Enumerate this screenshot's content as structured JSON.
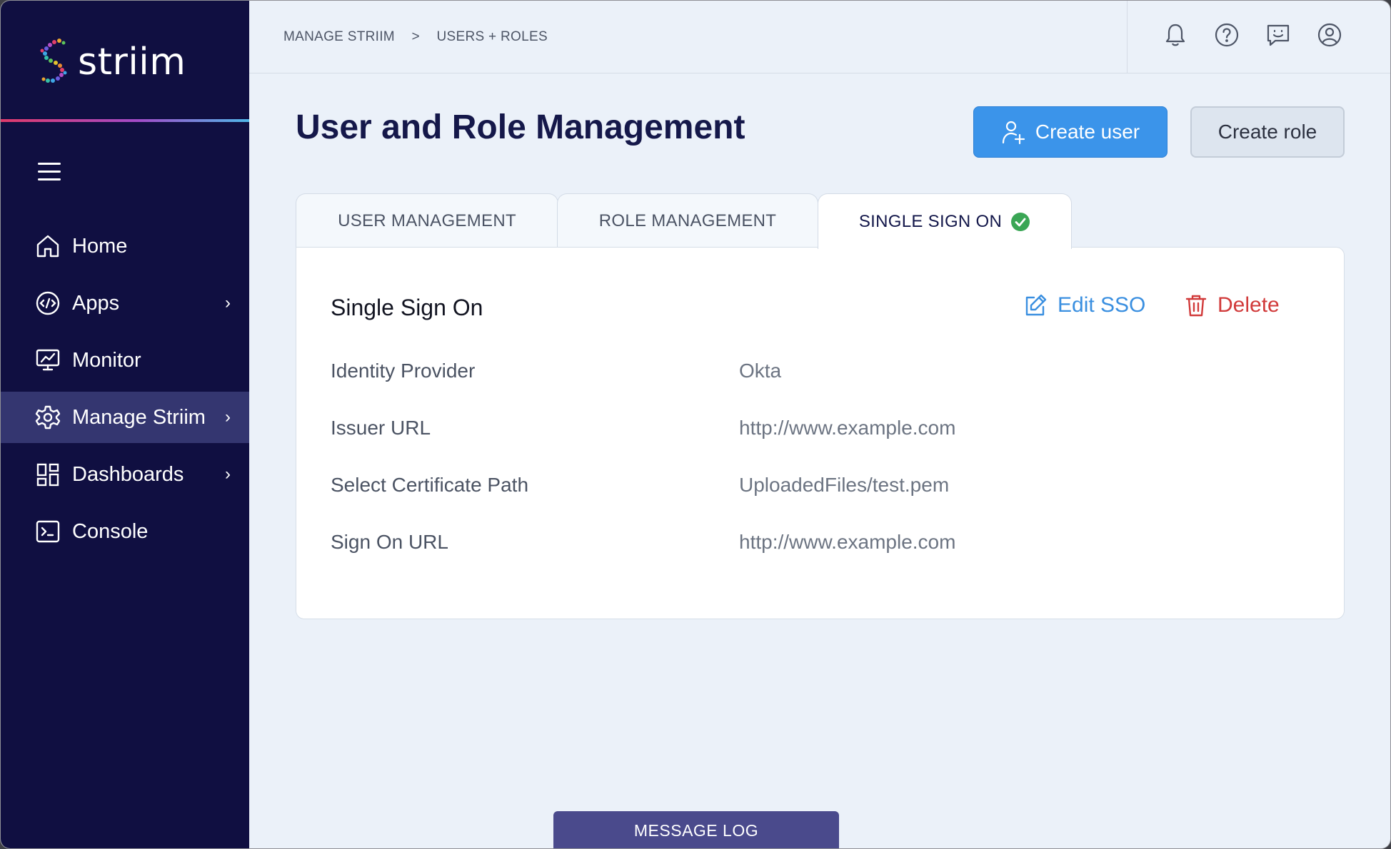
{
  "app": {
    "logo_text": "striim",
    "brand_color": "#100f41",
    "accent": "#3b94ea"
  },
  "sidebar": {
    "menu_icon": "hamburger-icon",
    "items": [
      {
        "label": "Home",
        "icon": "home-icon",
        "has_submenu": false,
        "active": false
      },
      {
        "label": "Apps",
        "icon": "apps-icon",
        "has_submenu": true,
        "active": false
      },
      {
        "label": "Monitor",
        "icon": "monitor-icon",
        "has_submenu": false,
        "active": false
      },
      {
        "label": "Manage Striim",
        "icon": "gear-icon",
        "has_submenu": true,
        "active": true
      },
      {
        "label": "Dashboards",
        "icon": "dashboards-icon",
        "has_submenu": true,
        "active": false
      },
      {
        "label": "Console",
        "icon": "console-icon",
        "has_submenu": false,
        "active": false
      }
    ]
  },
  "topbar": {
    "breadcrumb": [
      "MANAGE STRIIM",
      "USERS + ROLES"
    ],
    "separator": ">",
    "icons": [
      "bell-icon",
      "help-icon",
      "feedback-icon",
      "user-account-icon"
    ]
  },
  "page": {
    "title": "User and Role Management",
    "create_user_label": "Create user",
    "create_role_label": "Create role"
  },
  "tabs": [
    {
      "label": "USER MANAGEMENT",
      "active": false
    },
    {
      "label": "ROLE MANAGEMENT",
      "active": false
    },
    {
      "label": "SINGLE SIGN ON",
      "active": true,
      "status_icon": "check-circle-icon"
    }
  ],
  "sso": {
    "title": "Single Sign On",
    "edit_label": "Edit SSO",
    "delete_label": "Delete",
    "fields": [
      {
        "label": "Identity Provider",
        "value": "Okta"
      },
      {
        "label": "Issuer URL",
        "value": "http://www.example.com"
      },
      {
        "label": "Select Certificate Path",
        "value": "UploadedFiles/test.pem"
      },
      {
        "label": "Sign On URL",
        "value": "http://www.example.com"
      }
    ]
  },
  "footer": {
    "message_log_label": "MESSAGE LOG"
  },
  "colors": {
    "success": "#3aa655",
    "danger": "#d13a3a",
    "link": "#3a8fe0"
  }
}
